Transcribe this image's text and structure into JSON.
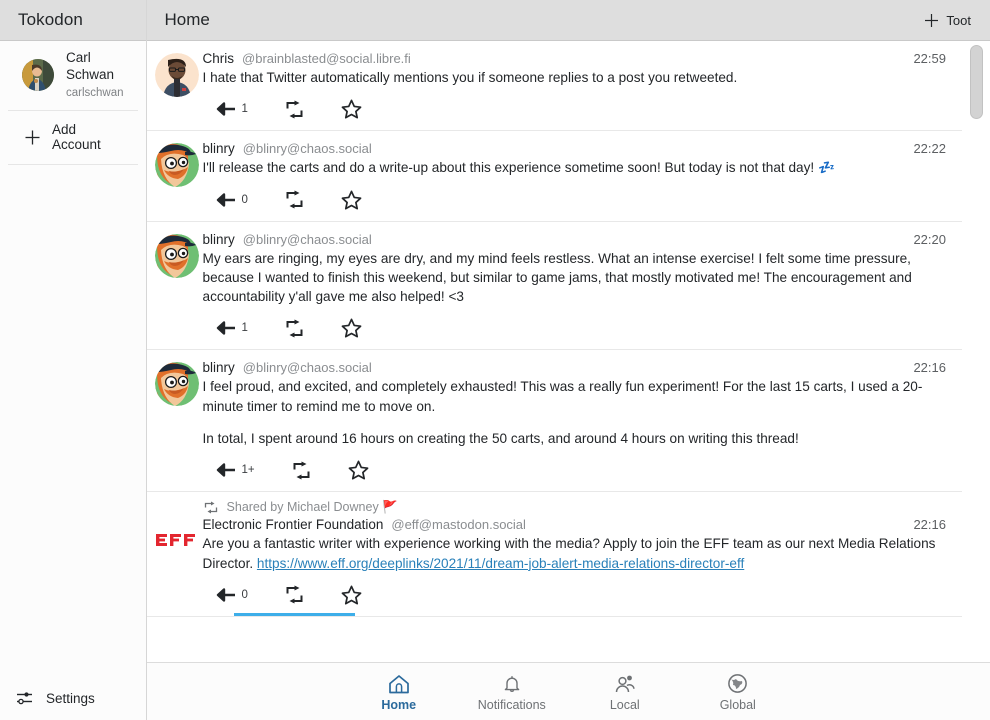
{
  "app": {
    "sidebar_title": "Tokodon",
    "main_title": "Home"
  },
  "sidebar": {
    "account": {
      "display_name": "Carl Schwan",
      "username": "carlschwan",
      "avatar_icon": "user-avatar"
    },
    "add_account": {
      "label": "Add Account",
      "icon": "plus-icon"
    },
    "settings": {
      "label": "Settings",
      "icon": "sliders-icon"
    }
  },
  "header": {
    "toot_button": {
      "label": "Toot",
      "icon": "plus-icon"
    }
  },
  "timeline": {
    "posts": [
      {
        "display_name": "Chris",
        "handle": "@brainblasted@social.libre.fi",
        "timestamp": "22:59",
        "avatar_icon": "avatar-chris",
        "paragraphs": [
          "I hate that Twitter automatically mentions you if someone replies to a post you retweeted."
        ],
        "reply_count": "1",
        "boosted_by": null,
        "link": null
      },
      {
        "display_name": "blinry",
        "handle": "@blinry@chaos.social",
        "timestamp": "22:22",
        "avatar_icon": "avatar-blinry",
        "paragraphs": [
          "I'll release the carts and do a write-up about this experience sometime soon! But today is not that day! 💤"
        ],
        "reply_count": "0",
        "boosted_by": null,
        "link": null
      },
      {
        "display_name": "blinry",
        "handle": "@blinry@chaos.social",
        "timestamp": "22:20",
        "avatar_icon": "avatar-blinry",
        "paragraphs": [
          "My ears are ringing, my eyes are dry, and my mind feels restless. What an intense exercise! I felt some time pressure, because I wanted to finish this weekend, but similar to game jams, that mostly motivated me! The encouragement and accountability y'all gave me also helped! <3"
        ],
        "reply_count": "1",
        "boosted_by": null,
        "link": null
      },
      {
        "display_name": "blinry",
        "handle": "@blinry@chaos.social",
        "timestamp": "22:16",
        "avatar_icon": "avatar-blinry",
        "paragraphs": [
          "I feel proud, and excited, and completely exhausted! This was a really fun experiment! For the last 15 carts, I used a 20-minute timer to remind me to move on.",
          "In total, I spent around 16 hours on creating the 50 carts, and around 4 hours on writing this thread!"
        ],
        "reply_count": "1+",
        "boosted_by": null,
        "link": null
      },
      {
        "display_name": "Electronic Frontier Foundation",
        "handle": "@eff@mastodon.social",
        "timestamp": "22:16",
        "avatar_icon": "avatar-eff",
        "paragraphs": [
          "Are you a fantastic writer with experience working with the media? Apply to join the EFF team as our next Media Relations Director. "
        ],
        "reply_count": "0",
        "boosted_by": "Shared by Michael Downey 🚩",
        "link": {
          "text": "https://www.eff.org/deeplinks/2021/11/dream-job-alert-media-relations-director-eff",
          "href": "#"
        }
      }
    ],
    "action_labels": {
      "reply": "reply-button",
      "boost": "boost-button",
      "favorite": "favorite-button"
    }
  },
  "bottom_nav": {
    "items": [
      {
        "label": "Home",
        "icon": "home-icon",
        "active": true
      },
      {
        "label": "Notifications",
        "icon": "bell-icon",
        "active": false
      },
      {
        "label": "Local",
        "icon": "people-icon",
        "active": false
      },
      {
        "label": "Global",
        "icon": "globe-icon",
        "active": false
      }
    ]
  },
  "colors": {
    "accent": "#3daee9",
    "link": "#2980b9",
    "header_bg": "#dedede",
    "active_nav": "#2b6a9c",
    "eff_red": "#e3262f"
  }
}
